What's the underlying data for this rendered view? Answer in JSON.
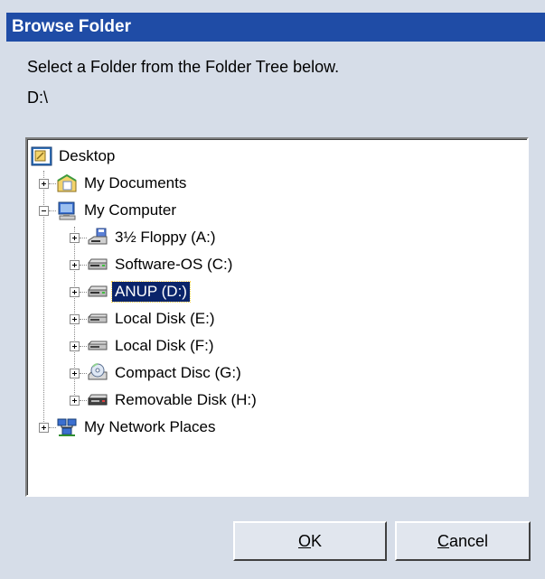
{
  "window": {
    "title": "Browse Folder"
  },
  "instruction": "Select a Folder from the Folder Tree below.",
  "current_path": "D:\\",
  "tree": {
    "desktop": "Desktop",
    "my_documents": "My Documents",
    "my_computer": "My Computer",
    "drives": [
      {
        "label": "3½ Floppy (A:)",
        "icon": "floppy-drive-icon"
      },
      {
        "label": "Software-OS (C:)",
        "icon": "hard-drive-icon"
      },
      {
        "label": "ANUP (D:)",
        "icon": "hard-drive-icon",
        "selected": true
      },
      {
        "label": "Local Disk (E:)",
        "icon": "hard-drive-icon"
      },
      {
        "label": "Local Disk (F:)",
        "icon": "hard-drive-icon"
      },
      {
        "label": "Compact Disc (G:)",
        "icon": "cd-drive-icon"
      },
      {
        "label": "Removable Disk (H:)",
        "icon": "removable-drive-icon"
      }
    ],
    "my_network_places": "My Network Places"
  },
  "buttons": {
    "ok_mnemonic": "O",
    "ok_rest": "K",
    "cancel_mnemonic": "C",
    "cancel_rest": "ancel"
  },
  "colors": {
    "titlebar": "#1f4ca6",
    "selection": "#0a246a",
    "dialog_background": "#d6dde8"
  }
}
